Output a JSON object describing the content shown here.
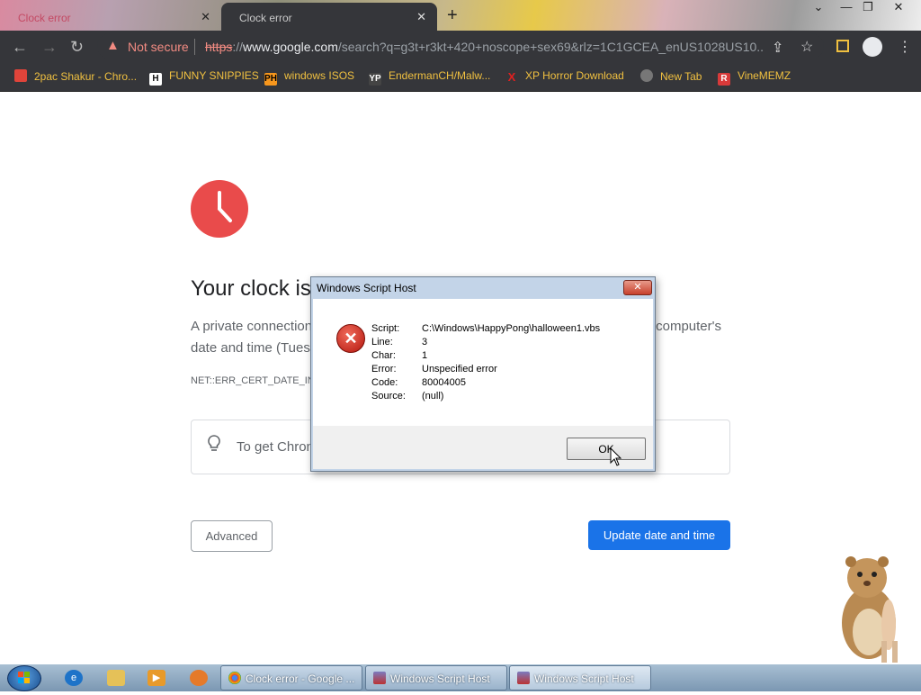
{
  "browser": {
    "tabs": [
      {
        "label": "Clock error",
        "close": "✕"
      },
      {
        "label": "Clock error",
        "close": "✕"
      }
    ],
    "new_tab": "+",
    "window_buttons": [
      "⌄",
      "—",
      "❐",
      "✕"
    ],
    "security_label": "Not secure",
    "url": {
      "scheme": "https",
      "separator": "://",
      "host": "www.google.com",
      "path": "/search?q=g3t+r3kt+420+noscope+sex69&rlz=1C1GCEA_enUS1028US10..."
    },
    "bookmarks": [
      {
        "label": "2pac Shakur - Chro...",
        "icon": "calendar-icon",
        "color": "#e0443a"
      },
      {
        "label": "FUNNY SNIPPIES",
        "icon": "h-letter-icon",
        "color": "#ffffff"
      },
      {
        "label": "windows ISOS",
        "icon": "ph-icon",
        "color": "#f7971d"
      },
      {
        "label": "EndermanCH/Malw...",
        "icon": "yp-icon",
        "color": "#444444"
      },
      {
        "label": "XP Horror Download",
        "icon": "x-icon",
        "color": "#e02020"
      },
      {
        "label": "New Tab",
        "icon": "globe-icon",
        "color": "#999999"
      },
      {
        "label": "VineMEMZ",
        "icon": "r-letter-icon",
        "color": "#d83a3a"
      }
    ]
  },
  "page": {
    "heading": "Your clock is",
    "description_start": "A private connection",
    "description_end": "computer's",
    "description_line2": "date and time (Tuesc",
    "error_code": "NET::ERR_CERT_DATE_INV",
    "tip": "To get Chron",
    "advanced_label": "Advanced",
    "update_label": "Update date and time",
    "accent": "#1a73e8",
    "clock_color": "#e94b4b"
  },
  "dialog": {
    "title": "Windows Script Host",
    "close": "✕",
    "rows": [
      {
        "label": "Script:",
        "value": "C:\\Windows\\HappyPong\\halloween1.vbs"
      },
      {
        "label": "Line:",
        "value": "3"
      },
      {
        "label": "Char:",
        "value": "1"
      },
      {
        "label": "Error:",
        "value": "Unspecified error"
      },
      {
        "label": "Code:",
        "value": "80004005"
      },
      {
        "label": "Source:",
        "value": "(null)"
      }
    ],
    "ok_label": "OK"
  },
  "taskbar": {
    "buttons": [
      {
        "label": "Clock error - Google ..."
      },
      {
        "label": "Windows Script Host"
      },
      {
        "label": "Windows Script Host"
      }
    ]
  }
}
